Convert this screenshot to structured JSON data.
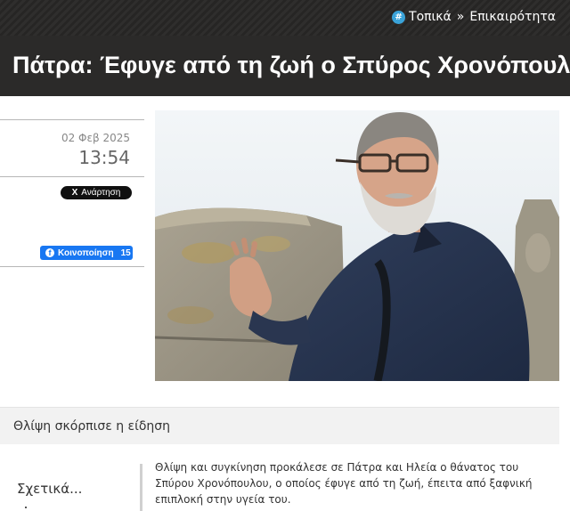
{
  "breadcrumb": {
    "hash_symbol": "#",
    "category": "Τοπικά",
    "separator": "»",
    "subcategory": "Επικαιρότητα"
  },
  "article": {
    "title": "Πάτρα: Έφυγε από τη ζωή ο Σπύρος Χρονόπουλος",
    "date": "02 Φεβ 2025",
    "time": "13:54",
    "lead": "Θλίψη σκόρπισε η είδηση",
    "body": "Θλίψη και συγκίνηση προκάλεσε σε Πάτρα και Ηλεία ο θάνατος του Σπύρου Χρονόπουλου, ο οποίος έφυγε από τη ζωή, έπειτα από ξαφνική επιπλοκή στην υγεία του."
  },
  "share": {
    "tweet_label": "Ανάρτηση",
    "tweet_icon": "X",
    "facebook_label": "Κοινοποίηση",
    "facebook_icon": "f",
    "facebook_count": "15"
  },
  "related": {
    "heading": "Σχετικά..."
  },
  "colors": {
    "header_bg": "#2b2a29",
    "hash_accent": "#3aa3d9",
    "facebook_blue": "#1877f2"
  }
}
